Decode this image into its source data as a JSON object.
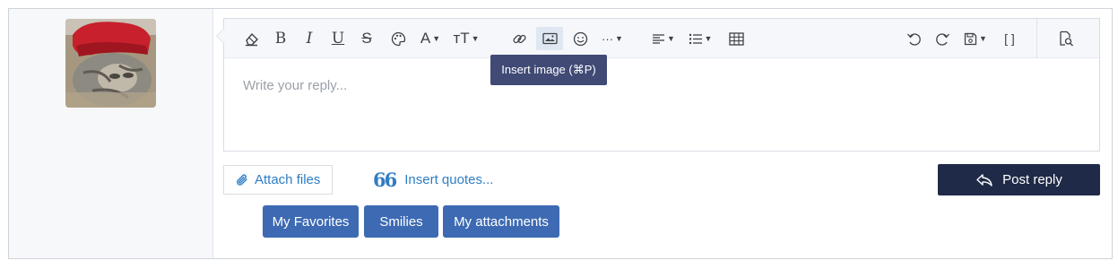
{
  "editor": {
    "placeholder": "Write your reply...",
    "tooltip": "Insert image (⌘P)",
    "toolbar": [
      "eraser-icon",
      "bold-icon",
      "italic-icon",
      "underline-icon",
      "strikethrough-icon",
      "palette-icon",
      "font-color-icon",
      "font-size-icon",
      "link-icon",
      "image-icon",
      "emoji-icon",
      "more-icon",
      "align-icon",
      "list-icon",
      "table-icon",
      "undo-icon",
      "redo-icon",
      "save-draft-icon",
      "bbcode-toggle-icon",
      "preview-icon"
    ],
    "toolbar_glyphs": {
      "bold": "B",
      "italic": "I",
      "underline": "U",
      "strike": "S",
      "font_color": "A",
      "font_size": "тT",
      "bbcode": "[ ]",
      "more": "···"
    }
  },
  "actions": {
    "attach_label": "Attach files",
    "quotes_label": "Insert quotes...",
    "quotes_glyph": "66",
    "post_label": "Post reply"
  },
  "tabs": [
    {
      "label": "My Favorites"
    },
    {
      "label": "Smilies"
    },
    {
      "label": "My attachments"
    }
  ],
  "colors": {
    "link": "#2f7dc4",
    "post_button": "#1e2a47",
    "tab_button": "#3d6ab3",
    "tooltip": "#404a75"
  }
}
